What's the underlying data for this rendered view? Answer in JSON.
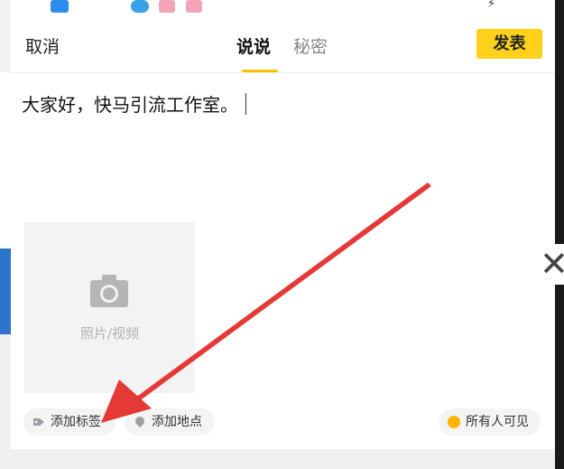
{
  "header": {
    "cancel_label": "取消",
    "tab_active_label": "说说",
    "tab_secondary_label": "秘密",
    "publish_label": "发表"
  },
  "composer": {
    "text": "大家好，快马引流工作室。"
  },
  "media": {
    "photo_video_label": "照片/视频"
  },
  "chips": {
    "add_tag_label": "添加标签",
    "add_location_label": "添加地点",
    "visibility_label": "所有人可见"
  },
  "colors": {
    "accent": "#ffd11a",
    "tab_underline": "#ffc107",
    "arrow": "#e53935"
  },
  "icons": {
    "camera": "camera-icon",
    "tag": "tag-icon",
    "location": "location-pin-icon",
    "visibility": "globe-icon"
  }
}
